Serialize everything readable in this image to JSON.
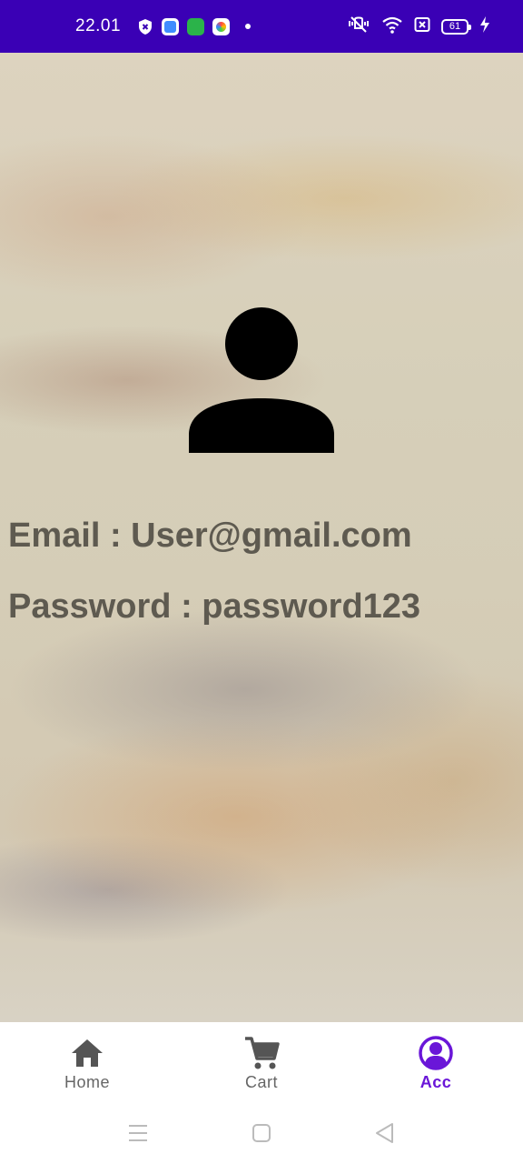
{
  "status_bar": {
    "time": "22.01",
    "battery": "61",
    "app_icons": [
      "shield-icon",
      "blue-app-icon",
      "green-app-icon",
      "photos-app-icon"
    ],
    "background_color": "#3a00b5"
  },
  "account": {
    "avatar_icon": "person-icon",
    "email_line": "Email : User@gmail.com",
    "password_line": "Password : password123"
  },
  "bottom_nav": {
    "items": [
      {
        "label": "Home",
        "icon": "home-icon",
        "active": false
      },
      {
        "label": "Cart",
        "icon": "cart-icon",
        "active": false
      },
      {
        "label": "Acc",
        "icon": "account-circle-icon",
        "active": true
      }
    ],
    "active_color": "#6a16d8",
    "inactive_color": "#666666"
  },
  "system_nav": {
    "buttons": [
      "menu-icon",
      "home-square-icon",
      "back-triangle-icon"
    ]
  }
}
